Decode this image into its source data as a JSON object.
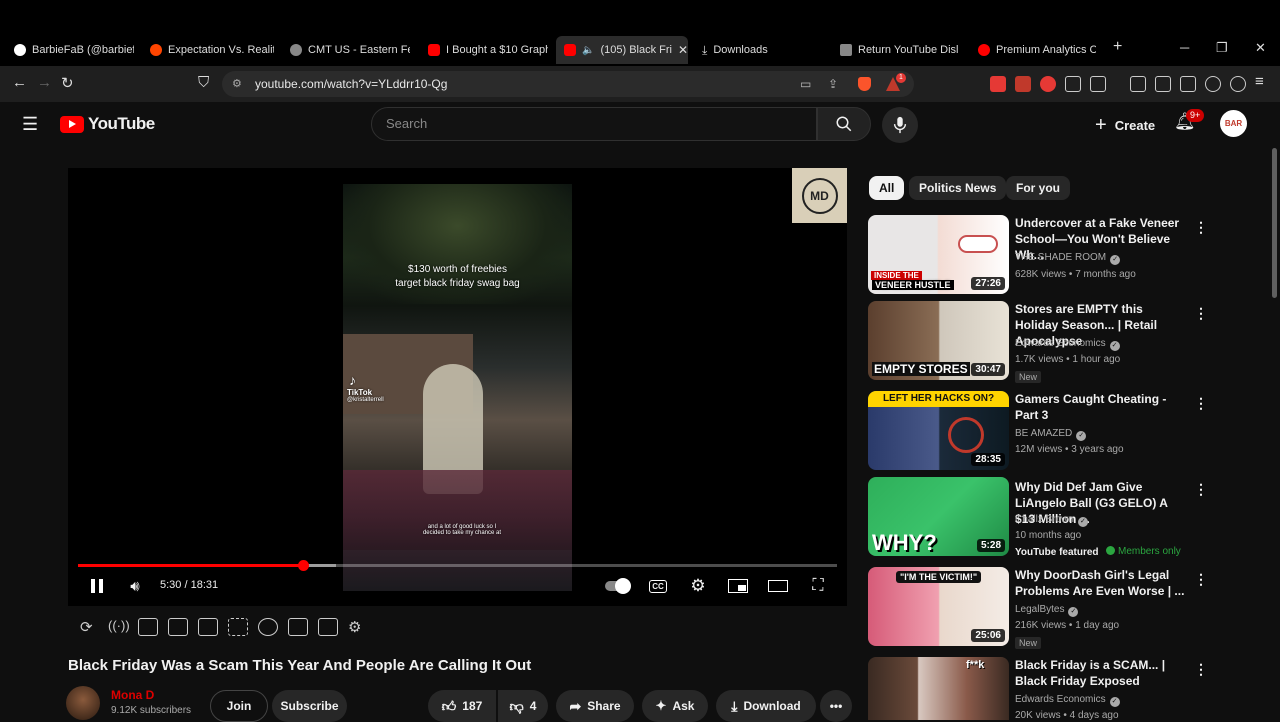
{
  "browser": {
    "tabs": [
      {
        "label": "BarbieFaB (@barbiefa",
        "color": "#ffffff"
      },
      {
        "label": "Expectation Vs. Reality",
        "color": "#ff4500"
      },
      {
        "label": "CMT US - Eastern Fee",
        "color": "#aaaaaa"
      },
      {
        "label": "I Bought a $10 Graph",
        "color": "#ff0000"
      },
      {
        "label": "(105) Black Fri",
        "color": "#ff0000"
      },
      {
        "label": "Downloads",
        "color": "#cccccc"
      },
      {
        "label": "Return YouTube Disli",
        "color": "#888888"
      },
      {
        "label": "Premium Analytics Ch",
        "color": "#ff0000"
      }
    ],
    "url": "youtube.com/watch?v=YLddrr10-Qg",
    "ext_badge": "1"
  },
  "youtube": {
    "logo_text": "YouTube",
    "search_placeholder": "Search",
    "create_label": "Create",
    "notif_count": "9+",
    "avatar_text": "BAR"
  },
  "player": {
    "overlay_logo": "MD",
    "video_caption_1": "$130 worth of freebies",
    "video_caption_2": "target black friday swag bag",
    "tiktok_label": "TikTok",
    "tiktok_user": "@kristalterrell",
    "video_subtitle": "and a lot of good luck so I decided to take my chance at",
    "time": "5:30 / 18:31",
    "progress_played": 0.296,
    "progress_buffered": 0.34
  },
  "video": {
    "title": "Black Friday Was a Scam This Year And People Are Calling It Out",
    "channel": "Mona D",
    "subscribers": "9.12K subscribers",
    "join": "Join",
    "subscribe": "Subscribe",
    "likes": "187",
    "dislikes": "4",
    "share": "Share",
    "ask": "Ask",
    "download": "Download"
  },
  "chips": [
    "All",
    "Politics News",
    "For you"
  ],
  "recommendations": [
    {
      "title": "Undercover at a Fake Veneer School—You Won't Believe Wh...",
      "channel": "THE SHADE ROOM",
      "meta": "628K views • 7 months ago",
      "duration": "27:26",
      "thumb_text": "VENEER HUSTLE",
      "badge": ""
    },
    {
      "title": "Stores are EMPTY this Holiday Season... | Retail Apocalypse",
      "channel": "Edwards Economics",
      "meta": "1.7K views • 1 hour ago",
      "duration": "30:47",
      "thumb_text": "EMPTY STORES",
      "badge": "New"
    },
    {
      "title": "Gamers Caught Cheating - Part 3",
      "channel": "BE AMAZED",
      "meta": "12M views • 3 years ago",
      "duration": "28:35",
      "thumb_text": "LEFT HER HACKS ON?",
      "badge": ""
    },
    {
      "title": "Why Did Def Jam Give LiAngelo Ball (G3 GELO) A $13 Million ...",
      "channel": "Challz Brown",
      "meta": "10 months ago",
      "duration": "5:28",
      "thumb_text": "WHY?",
      "badge": "",
      "featured": "YouTube featured",
      "members": "Members only"
    },
    {
      "title": "Why DoorDash Girl's Legal Problems Are Even Worse | ...",
      "channel": "LegalBytes",
      "meta": "216K views • 1 day ago",
      "duration": "25:06",
      "thumb_text": "\"I'M THE VICTIM!\"",
      "badge": "New"
    },
    {
      "title": "Black Friday is a SCAM... | Black Friday Exposed",
      "channel": "Edwards Economics",
      "meta": "20K views • 4 days ago",
      "duration": "",
      "thumb_text": "f**k",
      "badge": ""
    }
  ]
}
